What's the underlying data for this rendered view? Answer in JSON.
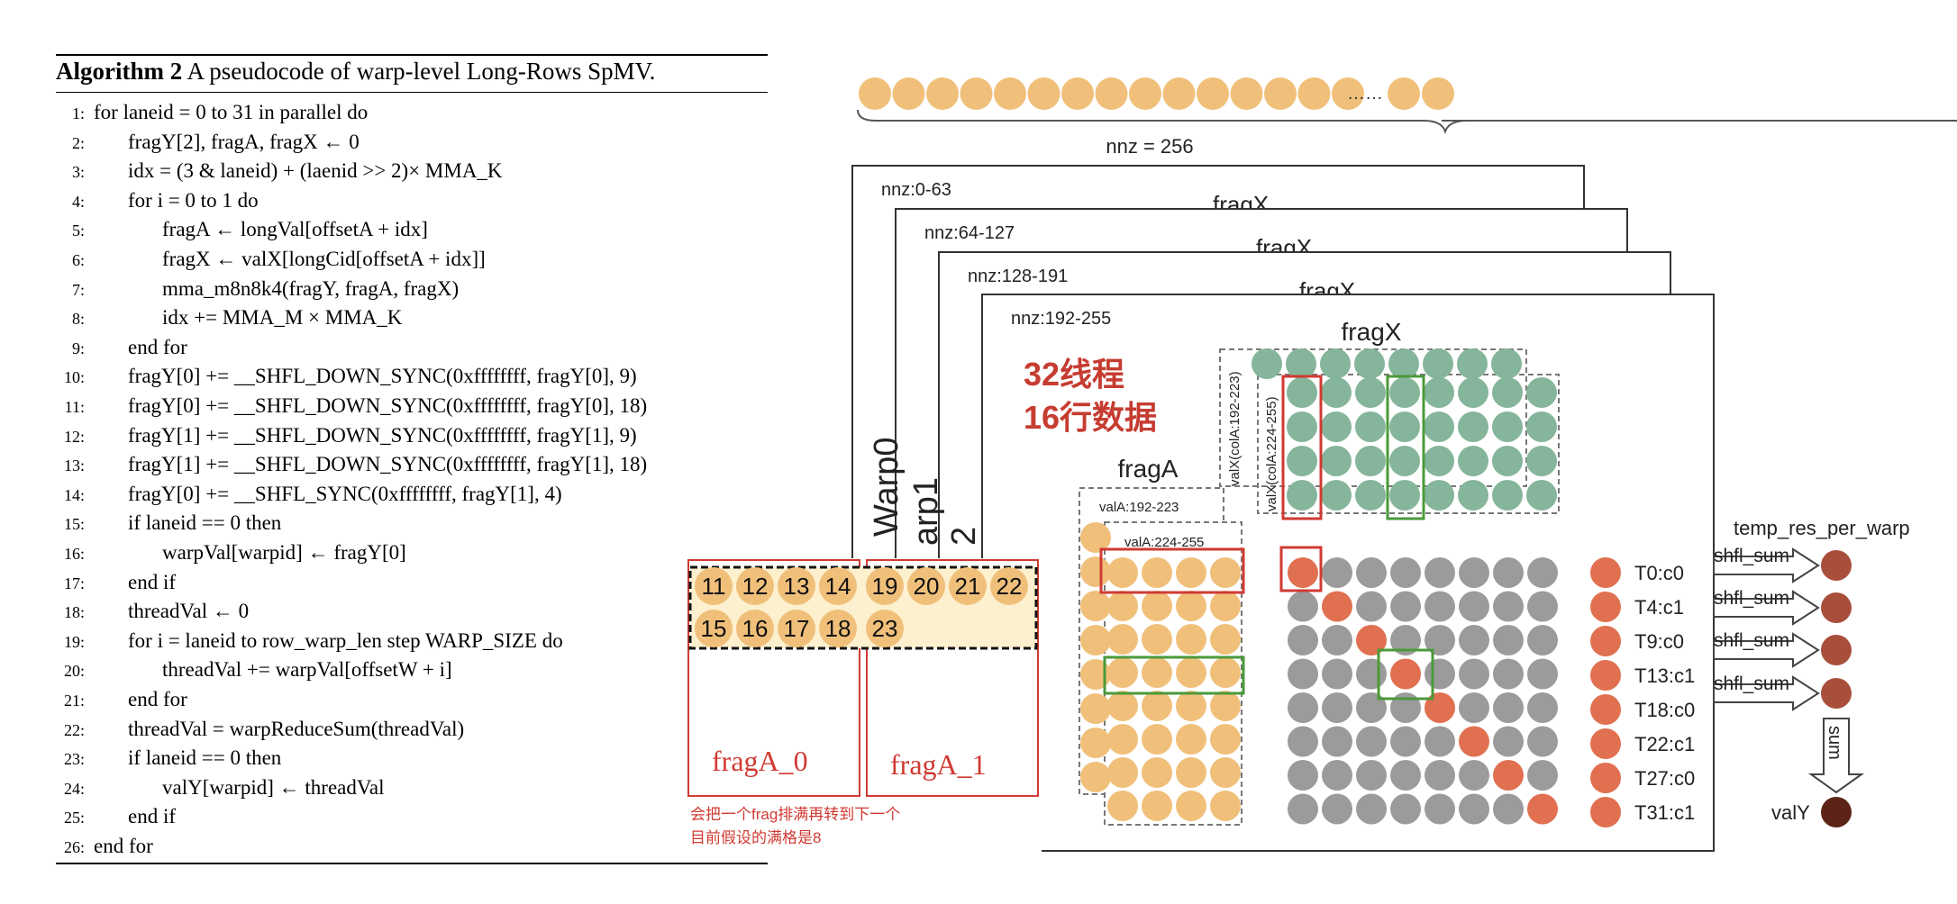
{
  "algorithm": {
    "title_bold": "Algorithm 2",
    "title_rest": " A pseudocode of warp-level Long-Rows SpMV.",
    "lines": [
      {
        "n": "1:",
        "indent": 0,
        "text": "for  laneid = 0 to 31 in parallel do"
      },
      {
        "n": "2:",
        "indent": 1,
        "text": "fragY[2], fragA, fragX ← 0"
      },
      {
        "n": "3:",
        "indent": 1,
        "text": "idx = (3 & laneid) + (laenid >> 2)× MMA_K"
      },
      {
        "n": "4:",
        "indent": 1,
        "text": "for  i = 0 to 1  do"
      },
      {
        "n": "5:",
        "indent": 2,
        "text": "fragA ← longVal[offsetA + idx]"
      },
      {
        "n": "6:",
        "indent": 2,
        "text": "fragX ← valX[longCid[offsetA + idx]]"
      },
      {
        "n": "7:",
        "indent": 2,
        "text": "mma_m8n8k4(fragY, fragA, fragX)"
      },
      {
        "n": "8:",
        "indent": 2,
        "text": "idx += MMA_M × MMA_K"
      },
      {
        "n": "9:",
        "indent": 1,
        "text": "end for"
      },
      {
        "n": "10:",
        "indent": 1,
        "text": "fragY[0] += __SHFL_DOWN_SYNC(0xffffffff, fragY[0], 9)"
      },
      {
        "n": "11:",
        "indent": 1,
        "text": "fragY[0] += __SHFL_DOWN_SYNC(0xffffffff, fragY[0], 18)"
      },
      {
        "n": "12:",
        "indent": 1,
        "text": "fragY[1] += __SHFL_DOWN_SYNC(0xffffffff, fragY[1], 9)"
      },
      {
        "n": "13:",
        "indent": 1,
        "text": "fragY[1] += __SHFL_DOWN_SYNC(0xffffffff, fragY[1], 18)"
      },
      {
        "n": "14:",
        "indent": 1,
        "text": "fragY[0] += __SHFL_SYNC(0xffffffff, fragY[1], 4)"
      },
      {
        "n": "15:",
        "indent": 1,
        "text": "if laneid == 0 then"
      },
      {
        "n": "16:",
        "indent": 2,
        "text": "warpVal[warpid] ← fragY[0]"
      },
      {
        "n": "17:",
        "indent": 1,
        "text": "end if"
      },
      {
        "n": "18:",
        "indent": 1,
        "text": "threadVal ← 0"
      },
      {
        "n": "19:",
        "indent": 1,
        "text": "for i = laneid to row_warp_len step WARP_SIZE do"
      },
      {
        "n": "20:",
        "indent": 2,
        "text": "threadVal += warpVal[offsetW + i]"
      },
      {
        "n": "21:",
        "indent": 1,
        "text": "end for"
      },
      {
        "n": "22:",
        "indent": 1,
        "text": "threadVal = warpReduceSum(threadVal)"
      },
      {
        "n": "23:",
        "indent": 1,
        "text": "if laneid == 0 then"
      },
      {
        "n": "24:",
        "indent": 2,
        "text": "valY[warpid] ← threadVal"
      },
      {
        "n": "25:",
        "indent": 1,
        "text": "end if"
      },
      {
        "n": "26:",
        "indent": 0,
        "text": "end for"
      }
    ]
  },
  "diagram": {
    "nnz_total": "nnz = 256",
    "ellipsis": "……",
    "card_labels": [
      "nnz:0-63",
      "nnz:64-127",
      "nnz:128-191",
      "nnz:192-255"
    ],
    "card_fragx": "fragX",
    "warp_labels": [
      "Warp0",
      "arp1",
      "2"
    ],
    "annotation_cn": [
      "32线程",
      "16行数据"
    ],
    "fragx_title": "fragX",
    "fragx_side_a": "valX(colA:192-223)",
    "fragx_side_b": "valX(colA:224-255)",
    "fraga_title": "fragA",
    "vala_a": "valA:192-223",
    "vala_b": "valA:224-255",
    "thread_labels": [
      "T0:c0",
      "T4:c1",
      "T9:c0",
      "T13:c1",
      "T18:c0",
      "T22:c1",
      "T27:c0",
      "T31:c1"
    ],
    "temp_res_label": "temp_res_per_warp",
    "shfl_labels": [
      "shfl_sum",
      "shfl_sum",
      "shfl_sum",
      "shfl_sum"
    ],
    "sum_label": "sum",
    "valy_label": "valY",
    "frag0_numbers_row1": [
      "11",
      "12",
      "13",
      "14"
    ],
    "frag0_numbers_row2": [
      "15",
      "16",
      "17",
      "18"
    ],
    "frag1_numbers_row1": [
      "19",
      "20",
      "21",
      "22"
    ],
    "frag1_numbers_row2": [
      "23"
    ],
    "frag0_label": "fragA_0",
    "frag1_label": "fragA_1",
    "note_cn": [
      "会把一个frag排满再转到下一个",
      "目前假设的满格是8"
    ]
  },
  "colors": {
    "orange_dot": "#f0c07a",
    "green_dot": "#85b59a",
    "gray_dot": "#9b9b9b",
    "red_dot": "#e07050",
    "dark_red_dot": "#a84f3c",
    "valy_dot": "#5c2418",
    "red_box": "#d03a32",
    "green_box": "#4a9a3a",
    "cn_text": "#c63c31"
  }
}
